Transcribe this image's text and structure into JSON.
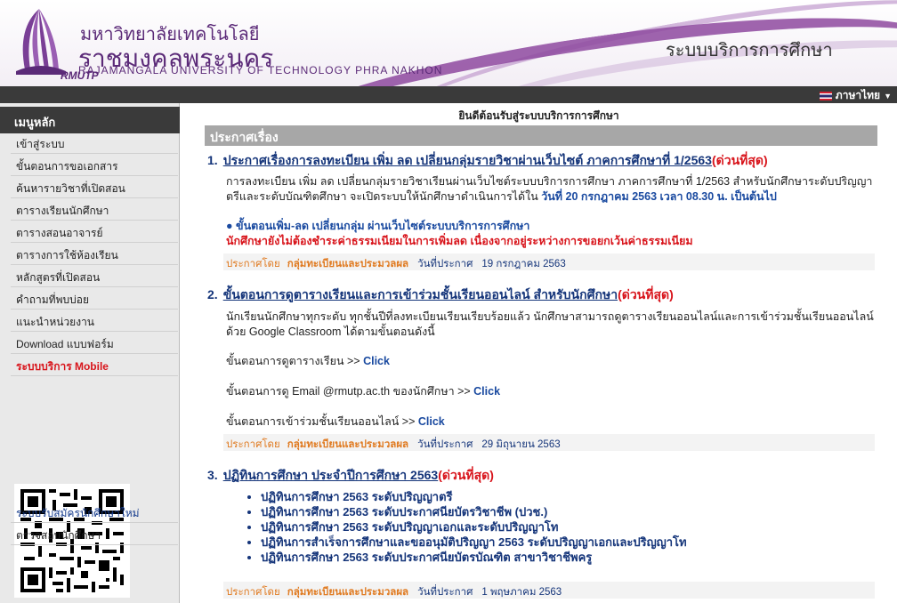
{
  "header": {
    "logo_text": "RMUTP",
    "university_th_line1": "มหาวิทยาลัยเทคโนโลยี",
    "university_th_line2": "ราชมงคลพระนคร",
    "university_en": "RAJAMANGALA UNIVERSITY   OF TECHNOLOGY PHRA NAKHON",
    "system_title": "ระบบบริการการศึกษา"
  },
  "language": {
    "label": "ภาษาไทย",
    "icon": "thai-flag-icon"
  },
  "sidebar": {
    "heading": "เมนูหลัก",
    "items": [
      {
        "label": "เข้าสู่ระบบ"
      },
      {
        "label": "ขั้นตอนการขอเอกสาร"
      },
      {
        "label": "ค้นหารายวิชาที่เปิดสอน"
      },
      {
        "label": "ตารางเรียนนักศึกษา"
      },
      {
        "label": "ตารางสอนอาจารย์"
      },
      {
        "label": "ตารางการใช้ห้องเรียน"
      },
      {
        "label": "หลักสูตรที่เปิดสอน"
      },
      {
        "label": "คำถามที่พบบ่อย"
      },
      {
        "label": "แนะนำหน่วยงาน"
      },
      {
        "label": "Download แบบฟอร์ม"
      },
      {
        "label": "ระบบบริการ Mobile"
      }
    ],
    "items_after_qr": [
      {
        "label": "ระบบรับสมัครนักศึกษาใหม่"
      },
      {
        "label": "ตรวจสอบนักศึกษา"
      }
    ]
  },
  "main": {
    "welcome": "ยินดีต้อนรับสู่ระบบบริการการศึกษา",
    "section_heading": "ประกาศเรื่อง",
    "meta_labels": {
      "posted_by": "ประกาศโดย",
      "posted_on": "วันที่ประกาศ"
    },
    "announcements": [
      {
        "num": "1.",
        "title": "ประกาศเรื่องการลงทะเบียน เพิ่ม ลด เปลี่ยนกลุ่มรายวิชาผ่านเว็บไซต์ ภาคการศึกษาที่ 1/2563",
        "urgent": "(ด่วนที่สุด)",
        "body_text": "การลงทะเบียน เพิ่ม ลด เปลี่ยนกลุ่มรายวิชาเรียนผ่านเว็บไซต์ระบบบริการการศึกษา ภาคการศึกษาที่ 1/2563 สำหรับนักศึกษาระดับปริญญาตรีและระดับบัณฑิตศึกษา จะเปิดระบบให้นักศึกษาดำเนินการได้ใน ",
        "body_highlight": "วันที่ 20 กรกฎาคม 2563 เวลา 08.30 น. เป็นต้นไป",
        "step_line": "● ขั้นตอนเพิ่ม-ลด เปลี่ยนกลุ่ม ผ่านเว็บไซต์ระบบบริการการศึกษา",
        "warning_line": "นักศึกษายังไม่ต้องชำระค่าธรรมเนียมในการเพิ่มลด เนื่องจากอยู่ระหว่างการขอยกเว้นค่าธรรมเนียม",
        "department": "กลุ่มทะเบียนและประมวลผล",
        "date": "19 กรกฎาคม 2563"
      },
      {
        "num": "2.",
        "title": "ขั้นตอนการดูตารางเรียนและการเข้าร่วมชั้นเรียนออนไลน์ สำหรับนักศึกษา",
        "urgent": "(ด่วนที่สุด)",
        "body_text": "นักเรียนนักศึกษาทุกระดับ ทุกชั้นปีที่ลงทะเบียนเรียนเรียบร้อยแล้ว นักศึกษาสามารถดูตารางเรียนออนไลน์และการเข้าร่วมชั้นเรียนออนไลน์ด้วย Google Classroom ได้ตามขั้นตอนดังนี้",
        "steps": [
          {
            "text": "ขั้นตอนการดูตารางเรียน >> ",
            "link": "Click"
          },
          {
            "text": "ขั้นตอนการดู Email @rmutp.ac.th ของนักศึกษา >> ",
            "link": "Click"
          },
          {
            "text": "ขั้นตอนการเข้าร่วมชั้นเรียนออนไลน์ >> ",
            "link": "Click"
          }
        ],
        "department": "กลุ่มทะเบียนและประมวลผล",
        "date": "29 มิถุนายน 2563"
      },
      {
        "num": "3.",
        "title": "ปฏิทินการศึกษา ประจำปีการศึกษา 2563",
        "urgent": "(ด่วนที่สุด)",
        "links": [
          "ปฏิทินการศึกษา 2563 ระดับปริญญาตรี",
          "ปฏิทินการศึกษา 2563 ระดับประกาศนียบัตรวิชาชีพ (ปวช.)",
          "ปฏิทินการศึกษา 2563 ระดับปริญญาเอกและระดับปริญญาโท",
          "ปฏิทินการสำเร็จการศึกษาและขออนุมัติปริญญา 2563 ระดับปริญญาเอกและปริญญาโท",
          "ปฏิทินการศึกษา 2563 ระดับประกาศนียบัตรบัณฑิต สาขาวิชาชีพครู"
        ],
        "department": "กลุ่มทะเบียนและประมวลผล",
        "date": "1 พฤษภาคม 2563"
      }
    ]
  },
  "colors": {
    "brand_purple": "#5b2a78",
    "dark_bar": "#3a3a3a",
    "link_blue": "#15357a",
    "urgent_red": "#d8141b",
    "meta_orange": "#e07a20"
  }
}
